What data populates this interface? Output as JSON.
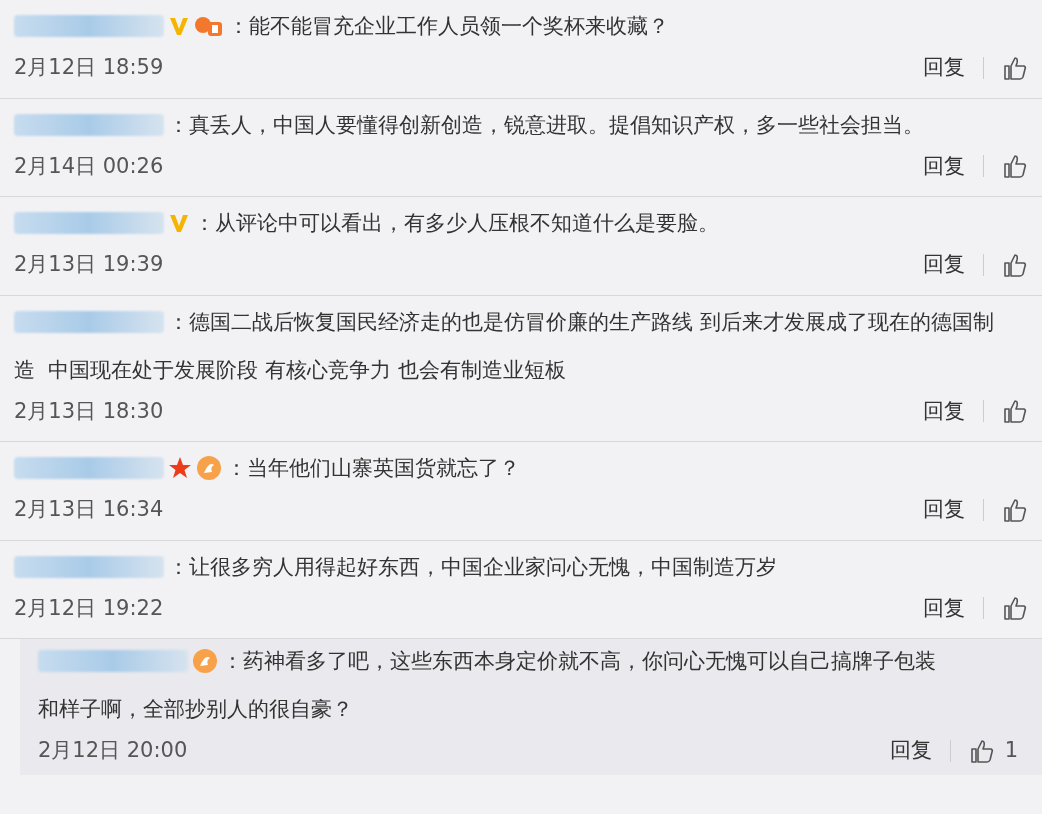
{
  "comments": [
    {
      "badges": [
        {
          "kind": "verified"
        },
        {
          "kind": "level"
        }
      ],
      "lines": [
        "：能不能冒充企业工作人员领一个奖杯来收藏？"
      ],
      "time": "2月12日 18:59",
      "reply": "回复"
    },
    {
      "lines": [
        "：真丢人，中国人要懂得创新创造，锐意进取。提倡知识产权，多一些社会担当。"
      ],
      "time": "2月14日 00:26",
      "reply": "回复"
    },
    {
      "badges": [
        {
          "kind": "verified"
        }
      ],
      "lines": [
        "：从评论中可以看出，有多少人压根不知道什么是要脸。"
      ],
      "time": "2月13日 19:39",
      "reply": "回复"
    },
    {
      "lines": [
        "：德国二战后恢复国民经济走的也是仿冒价廉的生产路线 到后来才发展成了现在的德国制",
        "造  中国现在处于发展阶段 有核心竞争力 也会有制造业短板"
      ],
      "time": "2月13日 18:30",
      "reply": "回复"
    },
    {
      "badges": [
        {
          "kind": "star"
        },
        {
          "kind": "fan"
        }
      ],
      "lines": [
        "：当年他们山寨英国货就忘了？"
      ],
      "time": "2月13日 16:34",
      "reply": "回复"
    },
    {
      "lines": [
        "：让很多穷人用得起好东西，中国企业家问心无愧，中国制造万岁"
      ],
      "time": "2月12日 19:22",
      "reply": "回复",
      "replies": [
        {
          "badges": [
            {
              "kind": "fan"
            }
          ],
          "lines": [
            "：药神看多了吧，这些东西本身定价就不高，你问心无愧可以自己搞牌子包装",
            "和样子啊，全部抄别人的很自豪？"
          ],
          "time": "2月12日 20:00",
          "reply": "回复",
          "likes": "1"
        }
      ]
    }
  ]
}
